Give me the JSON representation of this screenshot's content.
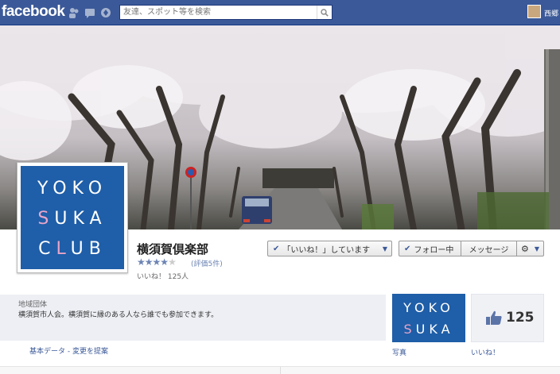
{
  "header": {
    "logo": "facebook",
    "search_placeholder": "友達、スポット等を検索",
    "user_name": "西郷"
  },
  "page": {
    "name": "横須賀倶楽部",
    "rating_stars": 4,
    "rating_max": 5,
    "review_count": "(評価5件)",
    "likes_line": "いいね！ 125人",
    "profile_logo_lines": [
      "YOKO",
      "SUKA",
      "CLUB"
    ]
  },
  "actions": {
    "like_label": "「いいね！」しています",
    "follow_label": "フォロー中",
    "message_label": "メッセージ",
    "gear_label": "⚙"
  },
  "about": {
    "category": "地域団体",
    "description": "横須賀市人会。横須賀に縁のある人なら誰でも参加できます。",
    "links": "基本データ - 変更を提案"
  },
  "apps": {
    "photo_logo_lines": [
      "YOKO",
      "SUKA"
    ],
    "photo_label": "写真",
    "likes_count": "125",
    "likes_label": "いいね！"
  },
  "colors": {
    "brand": "#3b5998",
    "club_blue": "#1f5ea8",
    "club_pink": "#e8a5c8"
  },
  "icons": [
    "friend-requests-icon",
    "messages-icon",
    "notifications-icon",
    "search-icon",
    "check-icon",
    "dropdown-arrow-icon",
    "gear-icon",
    "thumbs-up-icon",
    "star-icon"
  ]
}
